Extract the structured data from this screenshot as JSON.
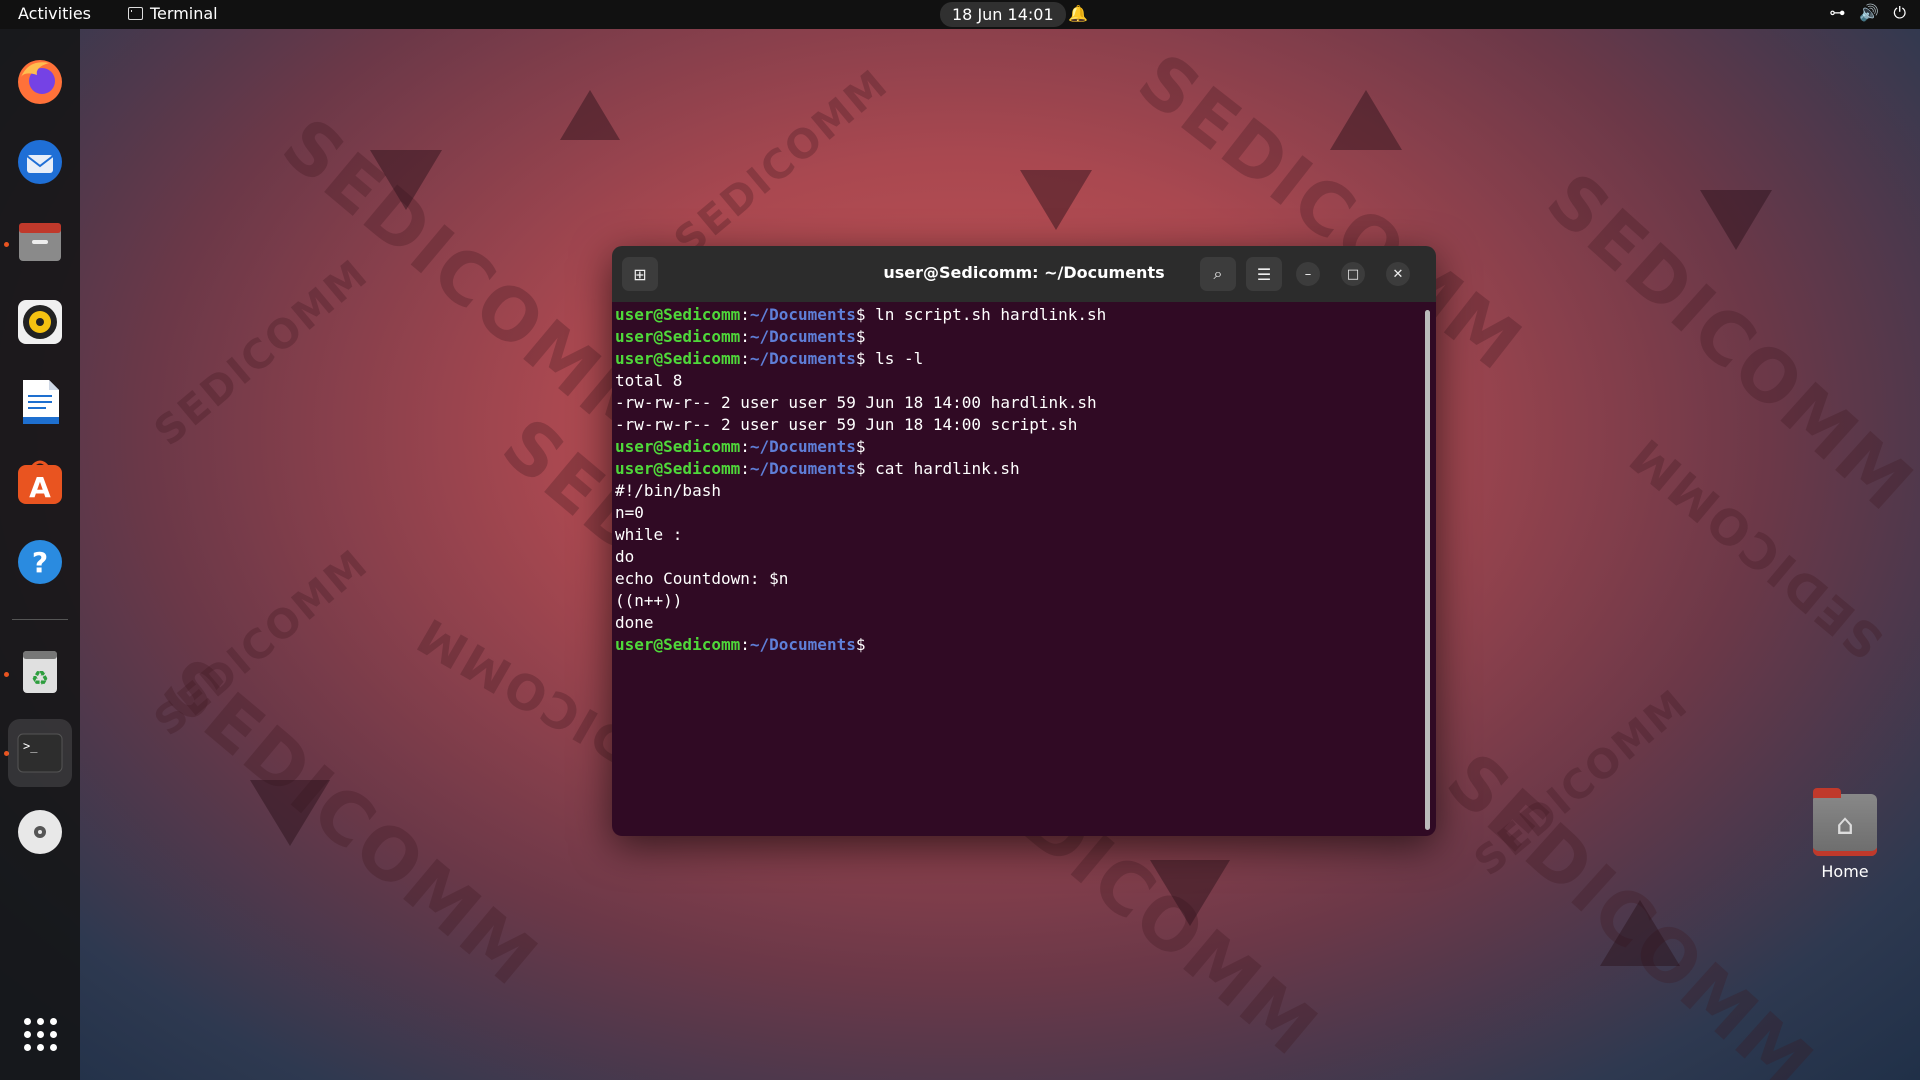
{
  "topbar": {
    "activities": "Activities",
    "app_name": "Terminal",
    "clock": "18 Jun  14:01"
  },
  "dock": {
    "items": [
      "firefox-icon",
      "thunderbird-icon",
      "files-icon",
      "rhythmbox-icon",
      "libreoffice-writer-icon",
      "app-center-icon",
      "help-icon",
      "trash-icon",
      "terminal-icon",
      "dvd-icon"
    ]
  },
  "desktop": {
    "home_label": "Home"
  },
  "terminal": {
    "title": "user@Sedicomm: ~/Documents",
    "prompt_user": "user@Sedicomm",
    "prompt_path": "~/Documents",
    "lines": [
      {
        "type": "cmd",
        "text": " ln script.sh hardlink.sh"
      },
      {
        "type": "cmd",
        "text": ""
      },
      {
        "type": "cmd",
        "text": " ls -l"
      },
      {
        "type": "out",
        "text": "total 8"
      },
      {
        "type": "out",
        "text": "-rw-rw-r-- 2 user user 59 Jun 18 14:00 hardlink.sh"
      },
      {
        "type": "out",
        "text": "-rw-rw-r-- 2 user user 59 Jun 18 14:00 script.sh"
      },
      {
        "type": "cmd",
        "text": ""
      },
      {
        "type": "cmd",
        "text": " cat hardlink.sh"
      },
      {
        "type": "out",
        "text": "#!/bin/bash"
      },
      {
        "type": "out",
        "text": "n=0"
      },
      {
        "type": "out",
        "text": "while :"
      },
      {
        "type": "out",
        "text": "do"
      },
      {
        "type": "out",
        "text": "echo Countdown: $n"
      },
      {
        "type": "out",
        "text": "((n++))"
      },
      {
        "type": "out",
        "text": "done"
      },
      {
        "type": "cmd",
        "text": ""
      }
    ]
  },
  "colors": {
    "terminal_bg": "#300a24",
    "prompt_user": "#4fd83a",
    "prompt_path": "#5f7fd8",
    "accent": "#e95420"
  }
}
